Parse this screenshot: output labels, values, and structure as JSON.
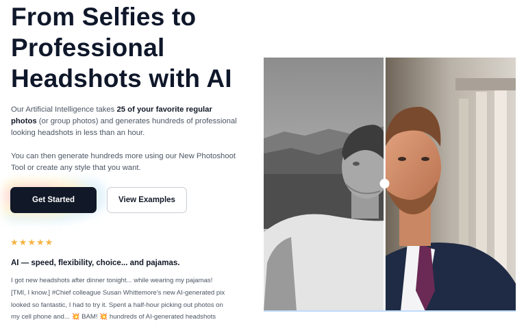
{
  "hero": {
    "title": "From Selfies to Professional Headshots with AI"
  },
  "description": {
    "p1_before": "Our Artificial Intelligence takes ",
    "p1_bold": "25 of your favorite regular photos",
    "p1_after": " (or group photos) and generates hundreds of professional looking headshots in less than an hour.",
    "p2": "You can then generate hundreds more using our New Photoshoot Tool or create any style that you want."
  },
  "buttons": {
    "get_started": "Get Started",
    "view_examples": "View Examples"
  },
  "rating": {
    "stars": 5,
    "star_glyph": "★",
    "star_color": "#f5b342"
  },
  "review": {
    "title": "AI — speed, flexibility, choice... and pajamas.",
    "line1": "I got new headshots after dinner tonight... while wearing my pajamas!",
    "line2": "[TMI, I know.] #Chief colleague Susan Whittemore's new AI-generated pix",
    "line3": "looked so fantastic, I had to try it. Spent a half-hour picking out photos on",
    "line4": "my cell phone and... 💥 BAM! 💥 hundreds of AI-generated headshots"
  },
  "comparison": {
    "left_label": "before-selfie",
    "right_label": "after-headshot",
    "slider_position": 0.48
  },
  "colors": {
    "primary_button": "#111827",
    "text_dark": "#0f172a",
    "text_muted": "#4b5563"
  }
}
